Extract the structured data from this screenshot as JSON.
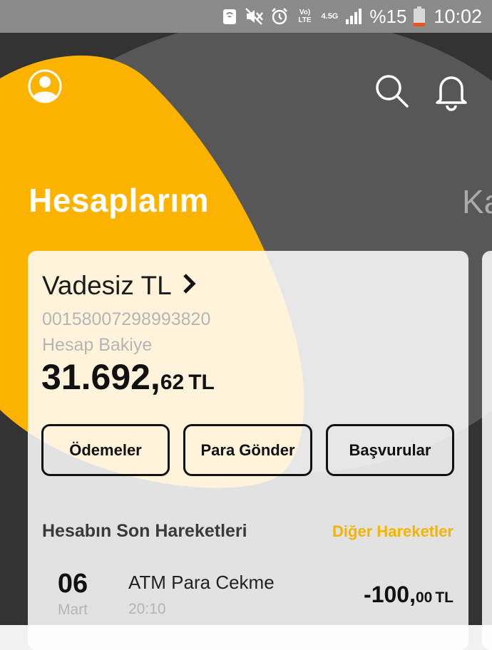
{
  "colors": {
    "dark_bg": "#333333",
    "dark_bg_light": "#545454",
    "accent_yellow": "#fbb300",
    "link_yellow": "#f5b400",
    "status_bar": "#8b8b8b"
  },
  "status_bar": {
    "battery_percent": "%15",
    "time": "10:02",
    "network_voice_lte": "Vo) LTE",
    "network_4g": "4.5G",
    "icons": [
      "nfc-icon",
      "mute-icon",
      "alarm-icon",
      "volte-icon",
      "network-45g-icon",
      "signal-icon",
      "battery-icon"
    ]
  },
  "header": {
    "title": "Hesaplarım",
    "next_title": "Ka",
    "icons": [
      "profile-icon",
      "search-icon",
      "bell-icon"
    ]
  },
  "account": {
    "name": "Vadesiz TL",
    "number": "00158007298993820",
    "balance_label": "Hesap Bakiye",
    "balance_integer": "31.692,",
    "balance_decimal": "62",
    "currency": "TL"
  },
  "actions": {
    "payments": "Ödemeler",
    "send_money": "Para Gönder",
    "applications": "Başvurular"
  },
  "transactions": {
    "title": "Hesabın Son Hareketleri",
    "more_link": "Diğer Hareketler",
    "items": [
      {
        "day": "06",
        "month": "Mart",
        "title": "ATM Para Cekme",
        "time": "20:10",
        "amount_integer": "-100,",
        "amount_decimal": "00",
        "currency": "TL"
      }
    ]
  }
}
